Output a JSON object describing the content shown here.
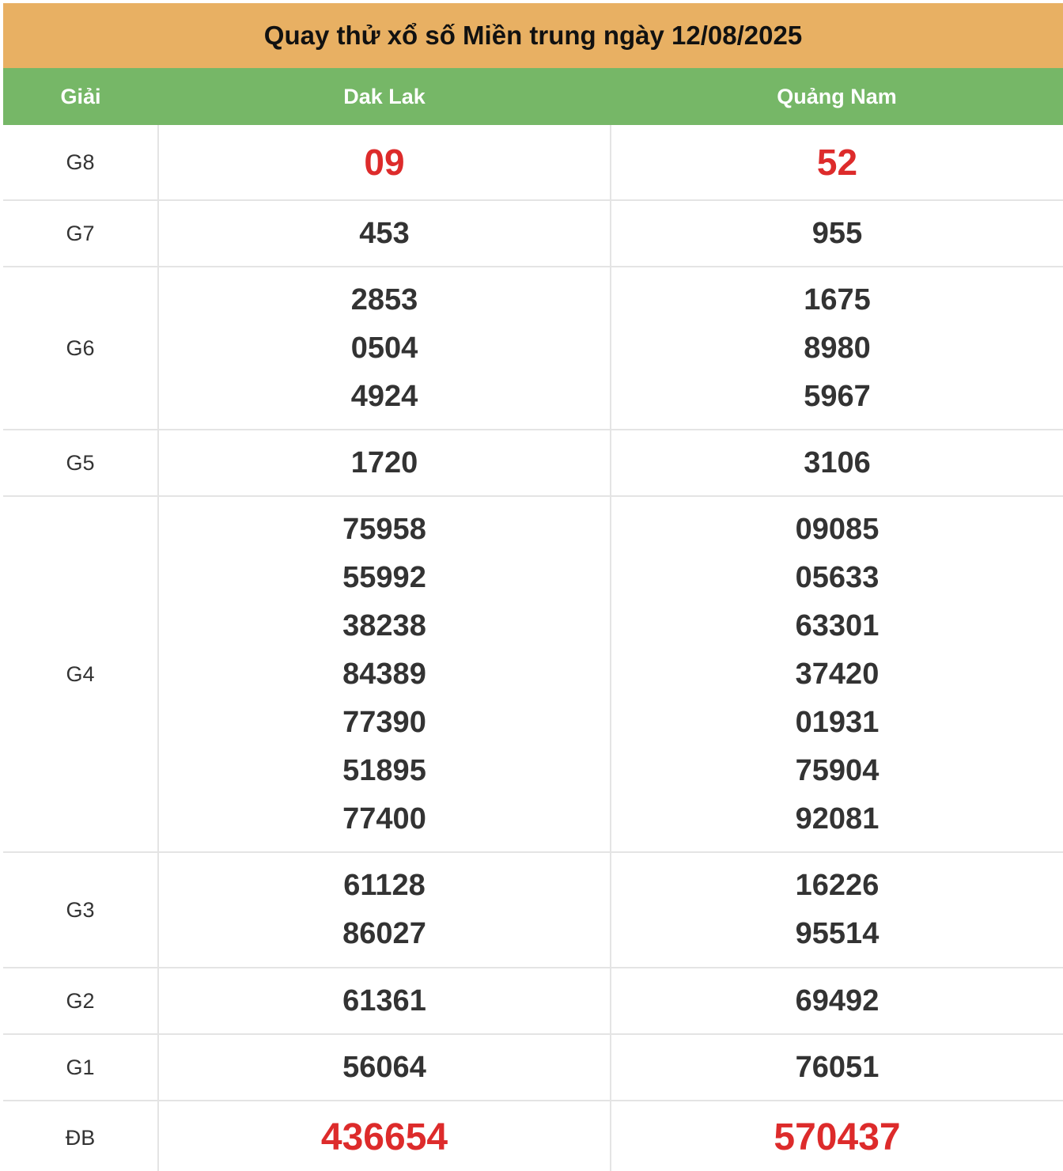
{
  "title": "Quay thử xổ số Miền trung ngày 12/08/2025",
  "colors": {
    "title_bg": "#e8b063",
    "header_bg": "#76b767",
    "highlight_red": "#dd2b2b",
    "number_text": "#333333"
  },
  "header": {
    "prize": "Giải",
    "province_1": "Dak Lak",
    "province_2": "Quảng Nam"
  },
  "rows": [
    {
      "prize": "G8",
      "p1": [
        "09"
      ],
      "p2": [
        "52"
      ]
    },
    {
      "prize": "G7",
      "p1": [
        "453"
      ],
      "p2": [
        "955"
      ]
    },
    {
      "prize": "G6",
      "p1": [
        "2853",
        "0504",
        "4924"
      ],
      "p2": [
        "1675",
        "8980",
        "5967"
      ]
    },
    {
      "prize": "G5",
      "p1": [
        "1720"
      ],
      "p2": [
        "3106"
      ]
    },
    {
      "prize": "G4",
      "p1": [
        "75958",
        "55992",
        "38238",
        "84389",
        "77390",
        "51895",
        "77400"
      ],
      "p2": [
        "09085",
        "05633",
        "63301",
        "37420",
        "01931",
        "75904",
        "92081"
      ]
    },
    {
      "prize": "G3",
      "p1": [
        "61128",
        "86027"
      ],
      "p2": [
        "16226",
        "95514"
      ]
    },
    {
      "prize": "G2",
      "p1": [
        "61361"
      ],
      "p2": [
        "69492"
      ]
    },
    {
      "prize": "G1",
      "p1": [
        "56064"
      ],
      "p2": [
        "76051"
      ]
    },
    {
      "prize": "ĐB",
      "p1": [
        "436654"
      ],
      "p2": [
        "570437"
      ]
    }
  ]
}
